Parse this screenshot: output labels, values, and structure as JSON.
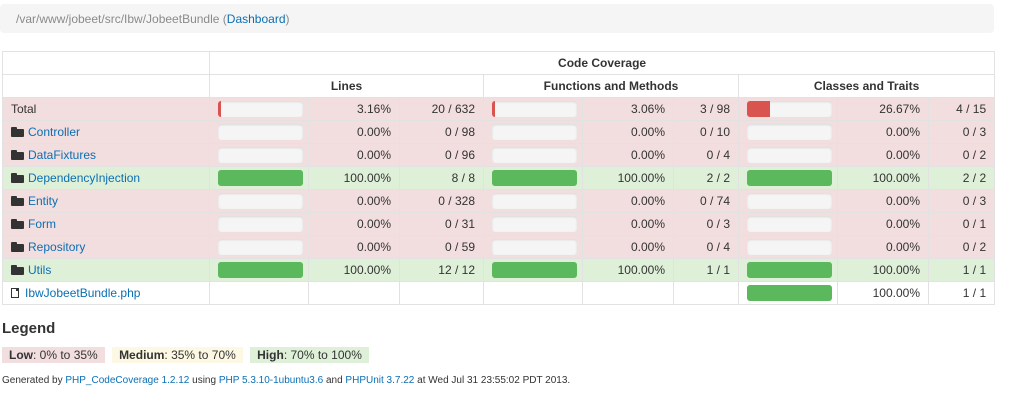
{
  "breadcrumb": {
    "path": "/var/www/jobeet/src/Ibw/JobeetBundle",
    "open_paren": " (",
    "link": "Dashboard",
    "close_paren": ")"
  },
  "table": {
    "group_header": "Code Coverage",
    "columns": [
      "Lines",
      "Functions and Methods",
      "Classes and Traits"
    ],
    "rows": [
      {
        "name": "Total",
        "type": "total",
        "status": "danger",
        "lines": {
          "pct_value": 3.16,
          "pct": "3.16%",
          "ratio": "20 / 632",
          "level": "danger"
        },
        "funcs": {
          "pct_value": 3.06,
          "pct": "3.06%",
          "ratio": "3 / 98",
          "level": "danger"
        },
        "classes": {
          "pct_value": 26.67,
          "pct": "26.67%",
          "ratio": "4 / 15",
          "level": "danger"
        }
      },
      {
        "name": "Controller",
        "type": "folder",
        "status": "danger",
        "lines": {
          "pct_value": 0,
          "pct": "0.00%",
          "ratio": "0 / 98",
          "level": "danger"
        },
        "funcs": {
          "pct_value": 0,
          "pct": "0.00%",
          "ratio": "0 / 10",
          "level": "danger"
        },
        "classes": {
          "pct_value": 0,
          "pct": "0.00%",
          "ratio": "0 / 3",
          "level": "danger"
        }
      },
      {
        "name": "DataFixtures",
        "type": "folder",
        "status": "danger",
        "lines": {
          "pct_value": 0,
          "pct": "0.00%",
          "ratio": "0 / 96",
          "level": "danger"
        },
        "funcs": {
          "pct_value": 0,
          "pct": "0.00%",
          "ratio": "0 / 4",
          "level": "danger"
        },
        "classes": {
          "pct_value": 0,
          "pct": "0.00%",
          "ratio": "0 / 2",
          "level": "danger"
        }
      },
      {
        "name": "DependencyInjection",
        "type": "folder",
        "status": "success",
        "lines": {
          "pct_value": 100,
          "pct": "100.00%",
          "ratio": "8 / 8",
          "level": "success"
        },
        "funcs": {
          "pct_value": 100,
          "pct": "100.00%",
          "ratio": "2 / 2",
          "level": "success"
        },
        "classes": {
          "pct_value": 100,
          "pct": "100.00%",
          "ratio": "2 / 2",
          "level": "success"
        }
      },
      {
        "name": "Entity",
        "type": "folder",
        "status": "danger",
        "lines": {
          "pct_value": 0,
          "pct": "0.00%",
          "ratio": "0 / 328",
          "level": "danger"
        },
        "funcs": {
          "pct_value": 0,
          "pct": "0.00%",
          "ratio": "0 / 74",
          "level": "danger"
        },
        "classes": {
          "pct_value": 0,
          "pct": "0.00%",
          "ratio": "0 / 3",
          "level": "danger"
        }
      },
      {
        "name": "Form",
        "type": "folder",
        "status": "danger",
        "lines": {
          "pct_value": 0,
          "pct": "0.00%",
          "ratio": "0 / 31",
          "level": "danger"
        },
        "funcs": {
          "pct_value": 0,
          "pct": "0.00%",
          "ratio": "0 / 3",
          "level": "danger"
        },
        "classes": {
          "pct_value": 0,
          "pct": "0.00%",
          "ratio": "0 / 1",
          "level": "danger"
        }
      },
      {
        "name": "Repository",
        "type": "folder",
        "status": "danger",
        "lines": {
          "pct_value": 0,
          "pct": "0.00%",
          "ratio": "0 / 59",
          "level": "danger"
        },
        "funcs": {
          "pct_value": 0,
          "pct": "0.00%",
          "ratio": "0 / 4",
          "level": "danger"
        },
        "classes": {
          "pct_value": 0,
          "pct": "0.00%",
          "ratio": "0 / 2",
          "level": "danger"
        }
      },
      {
        "name": "Utils",
        "type": "folder",
        "status": "success",
        "lines": {
          "pct_value": 100,
          "pct": "100.00%",
          "ratio": "12 / 12",
          "level": "success"
        },
        "funcs": {
          "pct_value": 100,
          "pct": "100.00%",
          "ratio": "1 / 1",
          "level": "success"
        },
        "classes": {
          "pct_value": 100,
          "pct": "100.00%",
          "ratio": "1 / 1",
          "level": "success"
        }
      },
      {
        "name": "IbwJobeetBundle.php",
        "type": "file",
        "status": "none",
        "lines": null,
        "funcs": null,
        "classes": {
          "pct_value": 100,
          "pct": "100.00%",
          "ratio": "1 / 1",
          "level": "success"
        }
      }
    ]
  },
  "legend": {
    "title": "Legend",
    "low": {
      "label": "Low",
      "range": ": 0% to 35%"
    },
    "medium": {
      "label": "Medium",
      "range": ": 35% to 70%"
    },
    "high": {
      "label": "High",
      "range": ": 70% to 100%"
    }
  },
  "footer": {
    "t1": "Generated by ",
    "link1": "PHP_CodeCoverage 1.2.12",
    "t2": " using ",
    "link2": "PHP 5.3.10-1ubuntu3.6",
    "t3": " and ",
    "link3": "PHPUnit 3.7.22",
    "t4": " at Wed Jul 31 23:55:02 PDT 2013."
  },
  "colors": {
    "danger_row": "#f2dede",
    "success_row": "#dff0d8",
    "warning": "#fcf8e3",
    "bar_danger": "#d9534f",
    "bar_success": "#5cb85c",
    "link": "#0b6fb3"
  },
  "icons": {
    "folder": "folder-open-icon",
    "file": "file-icon"
  }
}
